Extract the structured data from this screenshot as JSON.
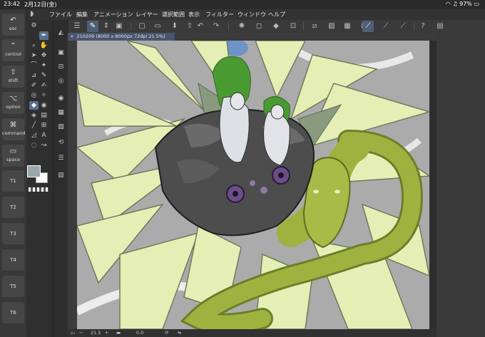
{
  "status_bar": {
    "time": "23:42",
    "date": "2月12日(金)",
    "battery": "97%"
  },
  "menu": [
    "ファイル",
    "編集",
    "アニメーション",
    "レイヤー",
    "選択範囲",
    "表示",
    "フィルター",
    "ウィンドウ",
    "ヘルプ"
  ],
  "keys": [
    {
      "glyph": "↶",
      "label": "esc"
    },
    {
      "glyph": "⌃",
      "label": "control"
    },
    {
      "glyph": "⇧",
      "label": "shift"
    },
    {
      "glyph": "⌥",
      "label": "option"
    },
    {
      "glyph": "⌘",
      "label": "command"
    },
    {
      "glyph": "▭",
      "label": "space"
    }
  ],
  "tkeys": [
    "T1",
    "T2",
    "T3",
    "T4",
    "T5",
    "T6"
  ],
  "document": {
    "tab_label": "210209 (8000 x 8000px 72dpi 21.5%)",
    "close_label": "×"
  },
  "bottom": {
    "zoom": "21.5",
    "angle": "0.0"
  },
  "colors": {
    "main_color": "#9aa6aa",
    "sub_color": "#ffffff"
  }
}
